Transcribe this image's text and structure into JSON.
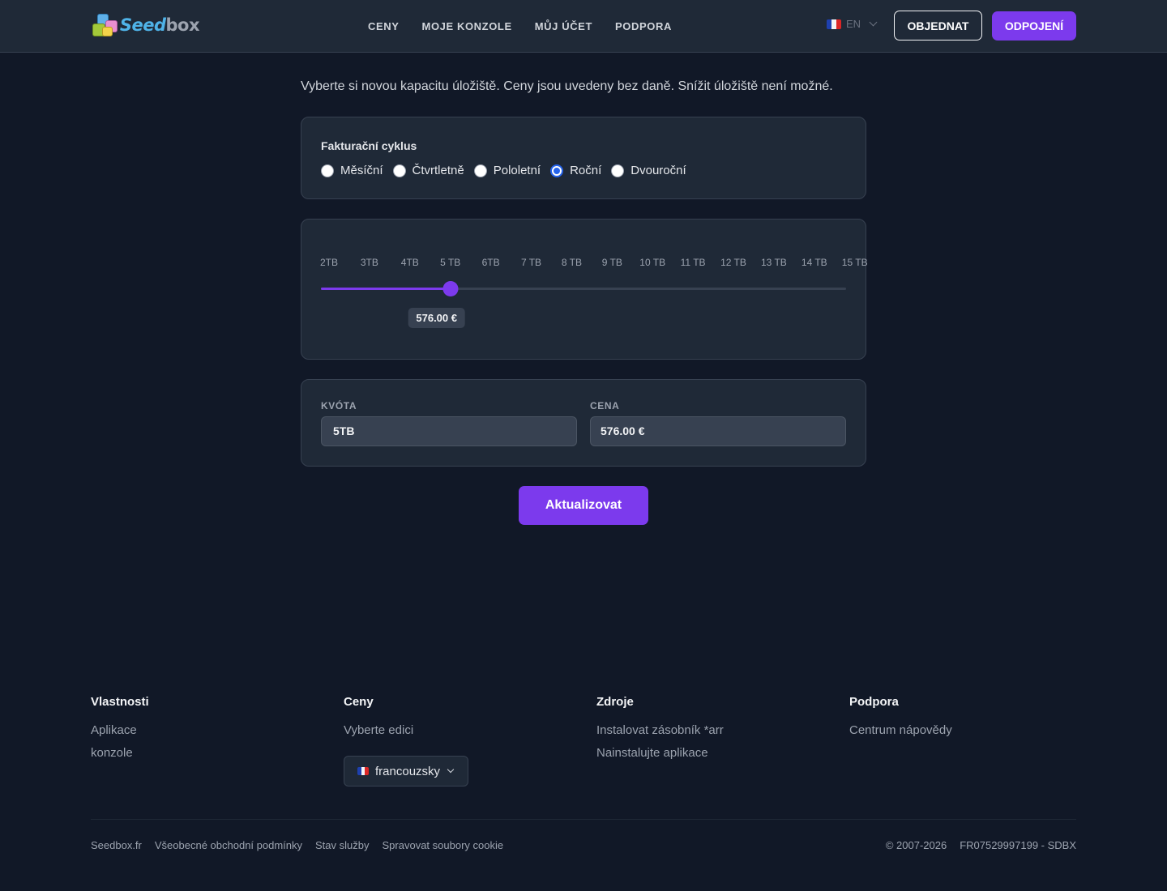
{
  "header": {
    "logo": {
      "part1": "Seed",
      "part2": "box"
    },
    "nav": [
      "CENY",
      "MOJE KONZOLE",
      "MŮJ ÚČET",
      "PODPORA"
    ],
    "language": "EN",
    "order_label": "OBJEDNAT",
    "logout_label": "ODPOJENÍ"
  },
  "main": {
    "intro": "Vyberte si novou kapacitu úložiště. Ceny jsou uvedeny bez daně. Snížit úložiště není možné.",
    "billing": {
      "label": "Fakturační cyklus",
      "options": [
        "Měsíční",
        "Čtvrtletně",
        "Pololetní",
        "Roční",
        "Dvouroční"
      ],
      "selected": "Roční"
    },
    "slider": {
      "ticks": [
        "2TB",
        "3TB",
        "4TB",
        "5 TB",
        "6TB",
        "7 TB",
        "8 TB",
        "9 TB",
        "10 TB",
        "11 TB",
        "12 TB",
        "13 TB",
        "14 TB",
        "15 TB"
      ],
      "selected_index": 3,
      "tooltip": "576.00 €"
    },
    "summary": {
      "quota_label": "KVÓTA",
      "quota_value": "5TB",
      "price_label": "CENA",
      "price_value": "576.00 €"
    },
    "update_label": "Aktualizovat"
  },
  "footer": {
    "columns": [
      {
        "title": "Vlastnosti",
        "links": [
          "Aplikace",
          "konzole"
        ]
      },
      {
        "title": "Ceny",
        "links": [
          "Vyberte edici"
        ]
      },
      {
        "title": "Zdroje",
        "links": [
          "Instalovat zásobník *arr",
          "Nainstalujte aplikace"
        ]
      },
      {
        "title": "Podpora",
        "links": [
          "Centrum nápovědy"
        ]
      }
    ],
    "language_select": "francouzsky",
    "bottom_links": [
      "Seedbox.fr",
      "Všeobecné obchodní podmínky",
      "Stav služby",
      "Spravovat soubory cookie"
    ],
    "copyright": "© 2007-2026",
    "company_id": "FR07529997199 - SDBX"
  }
}
